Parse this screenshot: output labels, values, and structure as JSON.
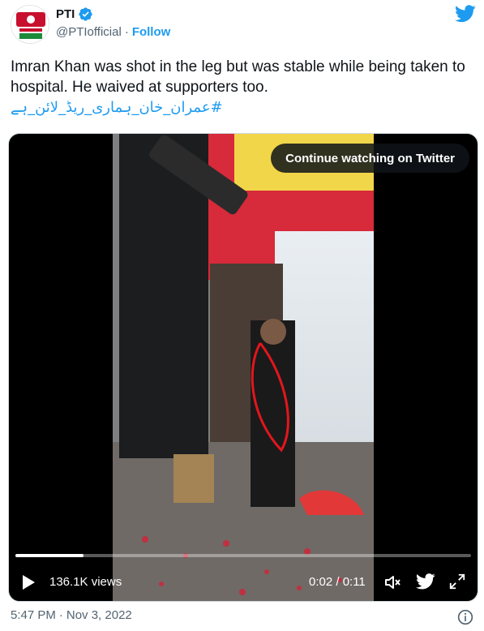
{
  "account": {
    "display_name": "PTI",
    "handle": "@PTIofficial",
    "separator": "·",
    "follow_label": "Follow"
  },
  "tweet": {
    "text": "Imran Khan was shot in the leg but was stable while being taken to hospital. He waived at supporters too.",
    "hashtag": "#عمران_خان_ہماری_ریڈ_لائن_ہے"
  },
  "video": {
    "continue_label": "Continue watching on Twitter",
    "views": "136.1K views",
    "time": "0:02 / 0:11",
    "progress_fraction": 0.15
  },
  "footer": {
    "time": "5:47 PM",
    "separator": "·",
    "date": "Nov 3, 2022"
  },
  "icons": {
    "verified": "verified-badge-icon",
    "twitter": "twitter-bird-icon",
    "play": "play-icon",
    "volume": "volume-icon",
    "fullscreen": "fullscreen-icon",
    "info": "info-icon"
  },
  "colors": {
    "accent": "#1d9bf0",
    "text": "#0f1419",
    "muted": "#536471"
  }
}
